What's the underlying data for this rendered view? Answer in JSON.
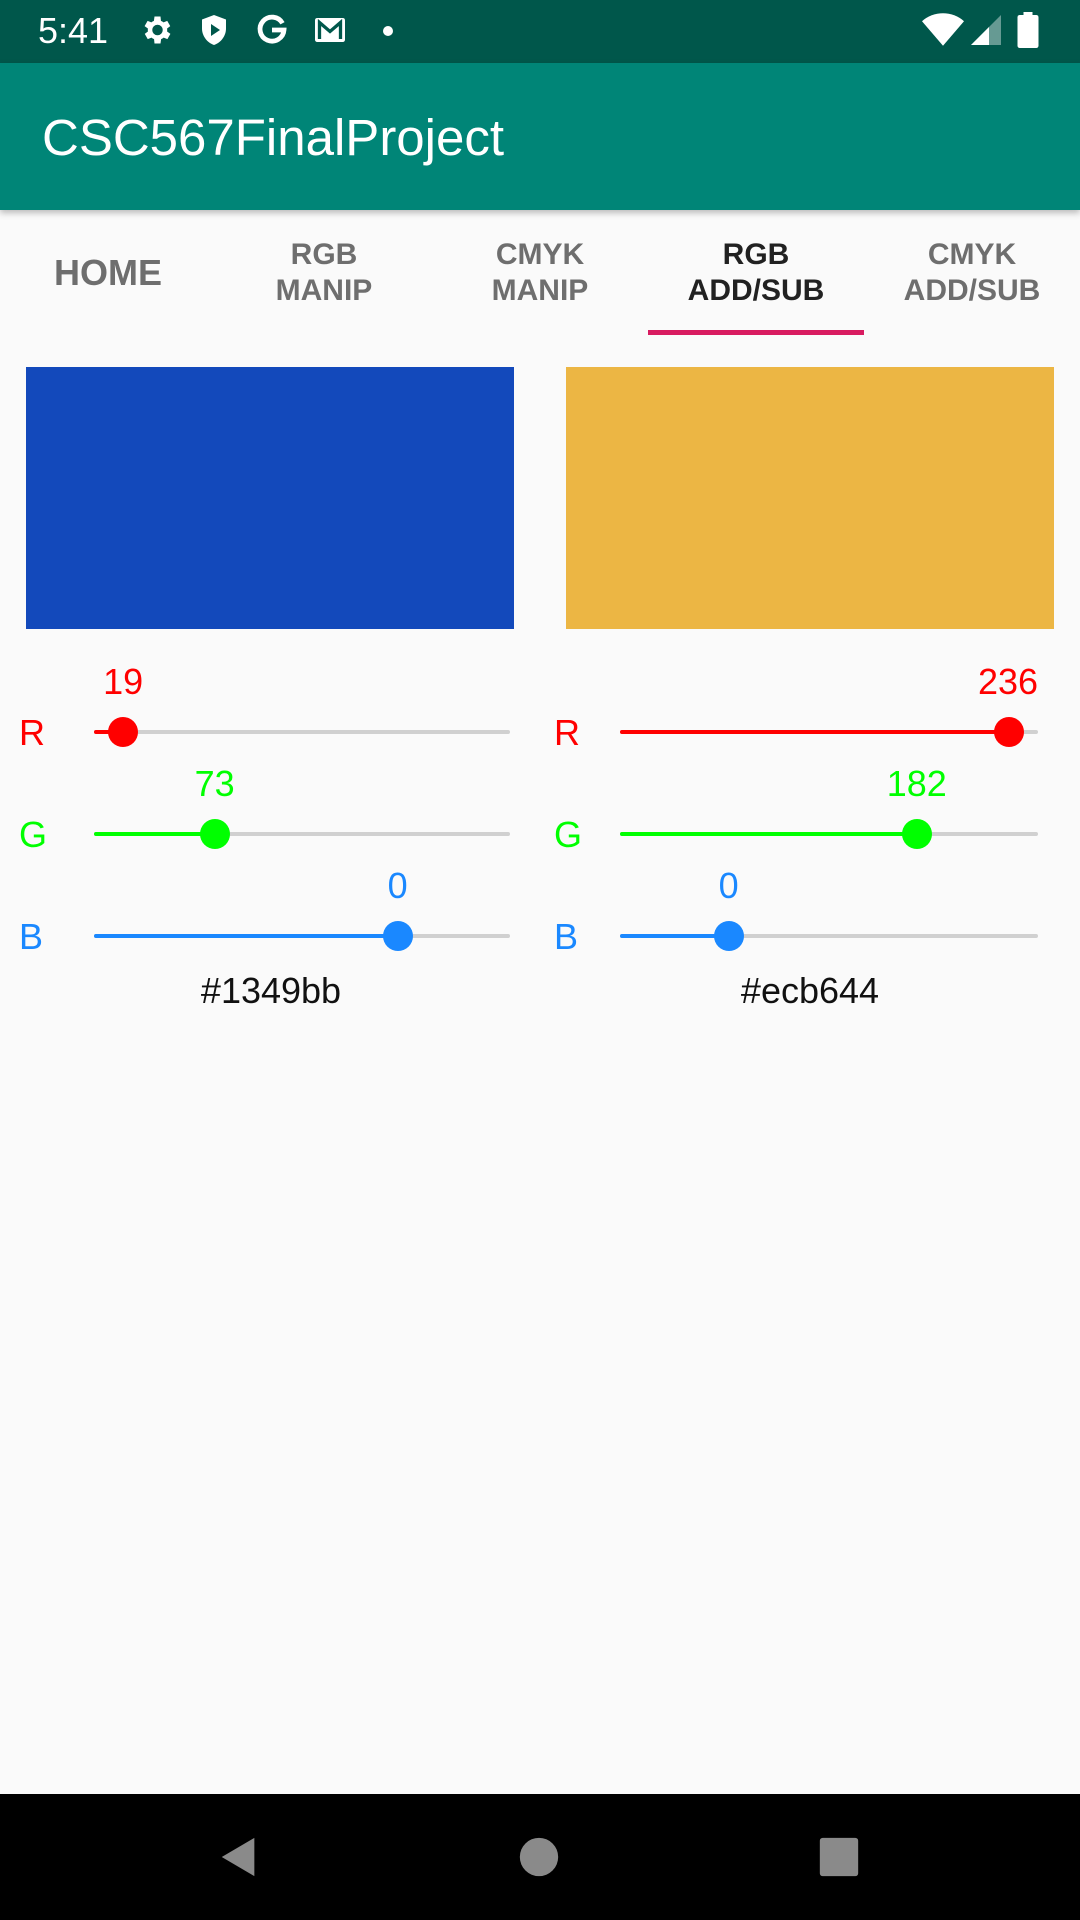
{
  "status_bar": {
    "time": "5:41",
    "icons": [
      "settings-icon",
      "shield-icon",
      "google-icon",
      "gmail-icon",
      "notification-dot-icon",
      "wifi-icon",
      "signal-icon",
      "battery-icon"
    ]
  },
  "app_bar": {
    "title": "CSC567FinalProject",
    "color": "#008577"
  },
  "tabs": [
    {
      "label": "HOME",
      "active": false
    },
    {
      "label": "RGB\nMANIP",
      "line1": "RGB",
      "line2": "MANIP",
      "active": false
    },
    {
      "label": "CMYK\nMANIP",
      "line1": "CMYK",
      "line2": "MANIP",
      "active": false
    },
    {
      "label": "RGB\nADD/SUB",
      "line1": "RGB",
      "line2": "ADD/SUB",
      "active": true
    },
    {
      "label": "CMYK\nADD/SUB",
      "line1": "CMYK",
      "line2": "ADD/SUB",
      "active": false
    }
  ],
  "accent_color": "#d81b60",
  "left_color": {
    "swatch_color": "#1349bb",
    "hex": "#1349bb",
    "channels": [
      {
        "letter": "R",
        "value": "19",
        "slider_fraction": 0.07,
        "color": "#ff0000"
      },
      {
        "letter": "G",
        "value": "73",
        "slider_fraction": 0.29,
        "color": "#00ff00"
      },
      {
        "letter": "B",
        "value": "0",
        "slider_fraction": 0.73,
        "color": "#1a88ff"
      }
    ]
  },
  "right_color": {
    "swatch_color": "#ecb644",
    "hex": "#ecb644",
    "channels": [
      {
        "letter": "R",
        "value": "236",
        "slider_fraction": 0.93,
        "color": "#ff0000"
      },
      {
        "letter": "G",
        "value": "182",
        "slider_fraction": 0.71,
        "color": "#00ff00"
      },
      {
        "letter": "B",
        "value": "0",
        "slider_fraction": 0.26,
        "color": "#1a88ff"
      }
    ]
  },
  "nav_bar": {
    "buttons": [
      "back-icon",
      "home-icon",
      "recents-icon"
    ]
  }
}
